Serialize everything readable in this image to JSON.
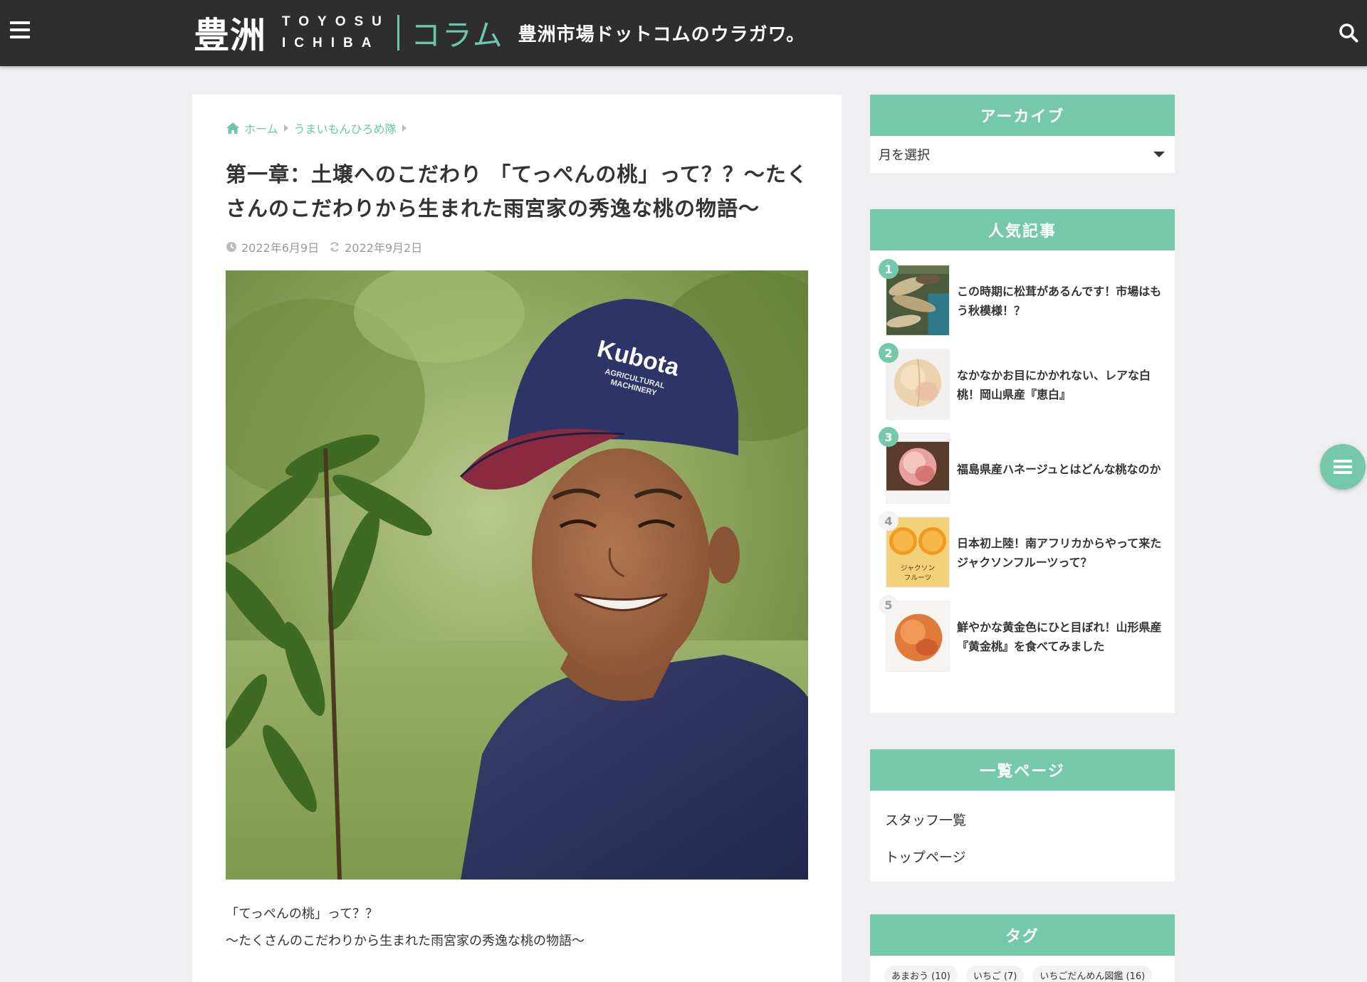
{
  "header": {
    "logo_kanji": "豊洲",
    "logo_latin_top": "TOYOSU",
    "logo_latin_bottom": "ICHIBA",
    "logo_column": "コラム",
    "tagline": "豊洲市場ドットコムのウラガワ。"
  },
  "breadcrumb": {
    "home": "ホーム",
    "category": "うまいもんひろめ隊"
  },
  "article": {
    "title": "第一章：土壌へのこだわり 「てっぺんの桃」って？？〜たくさんのこだわりから生まれた雨宮家の秀逸な桃の物語〜",
    "published": "2022年6月9日",
    "updated": "2022年9月2日",
    "cap_text": "Kubota",
    "cap_sub1": "AGRICULTURAL",
    "cap_sub2": "MACHINERY",
    "intro_line1": "「てっぺんの桃」って？？",
    "intro_line2": "〜たくさんのこだわりから生まれた雨宮家の秀逸な桃の物語〜"
  },
  "sidebar": {
    "archive": {
      "title": "アーカイブ",
      "select_label": "月を選択"
    },
    "popular": {
      "title": "人気記事",
      "items": [
        {
          "rank": "1",
          "title": "この時期に松茸があるんです！市場はもう秋模様！？"
        },
        {
          "rank": "2",
          "title": "なかなかお目にかかれない、レアな白桃！岡山県産『恵白』"
        },
        {
          "rank": "3",
          "title": "福島県産ハネージュとはどんな桃なのか"
        },
        {
          "rank": "4",
          "title": "日本初上陸！南アフリカからやって来たジャクソンフルーツって？",
          "thumb_text1": "ジャクソン",
          "thumb_text2": "フルーツ"
        },
        {
          "rank": "5",
          "title": "鮮やかな黄金色にひと目ぼれ！山形県産『黄金桃』を食べてみました"
        }
      ]
    },
    "pages": {
      "title": "一覧ページ",
      "links": [
        "スタッフ一覧",
        "トップページ"
      ]
    },
    "tags": {
      "title": "タグ",
      "items": [
        "あまおう (10)",
        "いちご (7)",
        "いちごだんめん図鑑 (16)"
      ]
    }
  },
  "colors": {
    "accent": "#76c8ab",
    "header_bg": "#2e2e2e",
    "page_bg": "#efeef0"
  }
}
